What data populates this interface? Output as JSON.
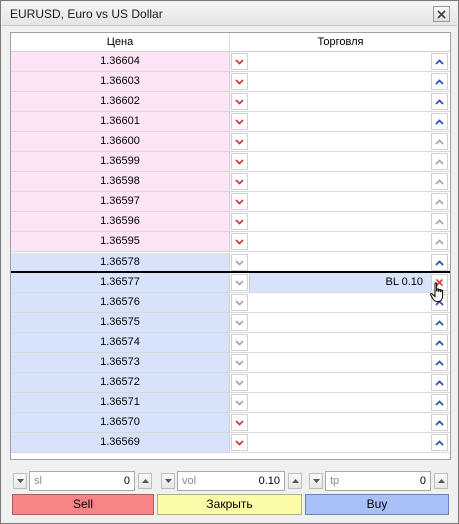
{
  "window": {
    "title": "EURUSD, Euro vs US Dollar"
  },
  "table": {
    "headers": {
      "price": "Цена",
      "trade": "Торговля"
    },
    "ask_rows": [
      {
        "price": "1.36604",
        "sell_active": true,
        "buy_active": true
      },
      {
        "price": "1.36603",
        "sell_active": true,
        "buy_active": true
      },
      {
        "price": "1.36602",
        "sell_active": true,
        "buy_active": true
      },
      {
        "price": "1.36601",
        "sell_active": true,
        "buy_active": true
      },
      {
        "price": "1.36600",
        "sell_active": true,
        "buy_active": false
      },
      {
        "price": "1.36599",
        "sell_active": true,
        "buy_active": false
      },
      {
        "price": "1.36598",
        "sell_active": true,
        "buy_active": false
      },
      {
        "price": "1.36597",
        "sell_active": true,
        "buy_active": false
      },
      {
        "price": "1.36596",
        "sell_active": true,
        "buy_active": false
      },
      {
        "price": "1.36595",
        "sell_active": true,
        "buy_active": false
      }
    ],
    "bid_rows": [
      {
        "price": "1.36578",
        "sell_active": false,
        "buy_active": true
      },
      {
        "price": "1.36577",
        "sell_active": false,
        "buy_active": false,
        "order": "BL 0.10"
      },
      {
        "price": "1.36576",
        "sell_active": false,
        "buy_active": true
      },
      {
        "price": "1.36575",
        "sell_active": false,
        "buy_active": true
      },
      {
        "price": "1.36574",
        "sell_active": false,
        "buy_active": true
      },
      {
        "price": "1.36573",
        "sell_active": false,
        "buy_active": true
      },
      {
        "price": "1.36572",
        "sell_active": false,
        "buy_active": true
      },
      {
        "price": "1.36571",
        "sell_active": false,
        "buy_active": true
      },
      {
        "price": "1.36570",
        "sell_active": true,
        "buy_active": true
      },
      {
        "price": "1.36569",
        "sell_active": true,
        "buy_active": true
      }
    ]
  },
  "controls": {
    "sl": {
      "label": "sl",
      "value": "0"
    },
    "vol": {
      "label": "vol",
      "value": "0.10"
    },
    "tp": {
      "label": "tp",
      "value": "0"
    }
  },
  "actions": {
    "sell": "Sell",
    "close": "Закрыть",
    "buy": "Buy"
  },
  "colors": {
    "ask_bg": "#fde4f7",
    "bid_bg": "#d6e3fa",
    "sell_btn": "#f78585",
    "close_btn": "#fcfca8",
    "buy_btn": "#a9c1f7",
    "arrow_red": "#d03a3a",
    "arrow_blue": "#2f4fb8",
    "arrow_grey": "#a8a8a8"
  },
  "icons": {
    "sell": "chevron-down-icon",
    "buy": "chevron-up-icon",
    "cancel": "close-icon",
    "cursor": "hand-pointer-icon"
  }
}
